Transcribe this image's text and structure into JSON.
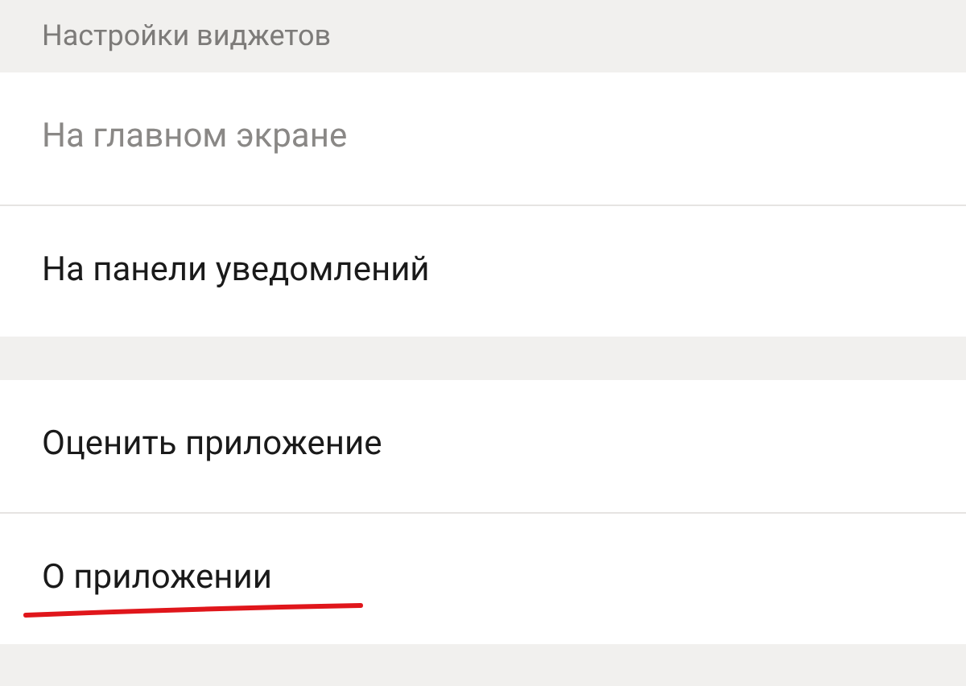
{
  "sections": [
    {
      "header": "Настройки виджетов",
      "items": [
        {
          "label": "На главном экране",
          "disabled": true
        },
        {
          "label": "На панели уведомлений",
          "disabled": false
        }
      ]
    },
    {
      "items": [
        {
          "label": "Оценить приложение",
          "disabled": false
        },
        {
          "label": "О приложении",
          "disabled": false,
          "underlined": true
        }
      ]
    }
  ]
}
